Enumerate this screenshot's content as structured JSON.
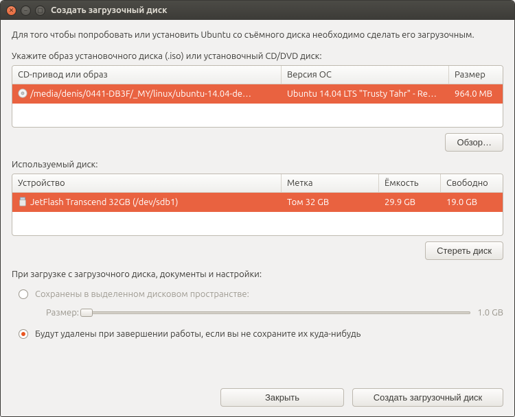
{
  "window": {
    "title": "Создать загрузочный диск"
  },
  "intro": "Для того чтобы попробовать или установить Ubuntu со съёмного диска необходимо сделать его загрузочным.",
  "source": {
    "label": "Укажите образ установочного диска (.iso) или установочный CD/DVD диск:",
    "columns": {
      "drive": "CD-привод или образ",
      "os": "Версия ОС",
      "size": "Размер"
    },
    "row": {
      "drive": "/media/denis/0441-DB3F/_MY/linux/ubuntu-14.04-de…",
      "os": "Ubuntu 14.04 LTS \"Trusty Tahr\" - Re…",
      "size": "964.0 MB"
    },
    "browse_label": "Обзор…"
  },
  "target": {
    "label": "Используемый диск:",
    "columns": {
      "device": "Устройство",
      "volume": "Метка",
      "capacity": "Ёмкость",
      "free": "Свободно"
    },
    "row": {
      "device": "JetFlash Transcend 32GB (/dev/sdb1)",
      "volume": "Том 32 GB",
      "capacity": "29.9 GB",
      "free": "19.0 GB"
    },
    "erase_label": "Стереть диск"
  },
  "persist": {
    "heading": "При загрузке с загрузочного диска, документы и настройки:",
    "opt_keep": "Сохранены в выделенном дисковом пространстве:",
    "size_label": "Размер:",
    "size_value": "1.0 GB",
    "opt_discard": "Будут удалены при завершении работы, если вы не сохраните их куда-нибудь"
  },
  "footer": {
    "close": "Закрыть",
    "make": "Создать загрузочный диск"
  }
}
